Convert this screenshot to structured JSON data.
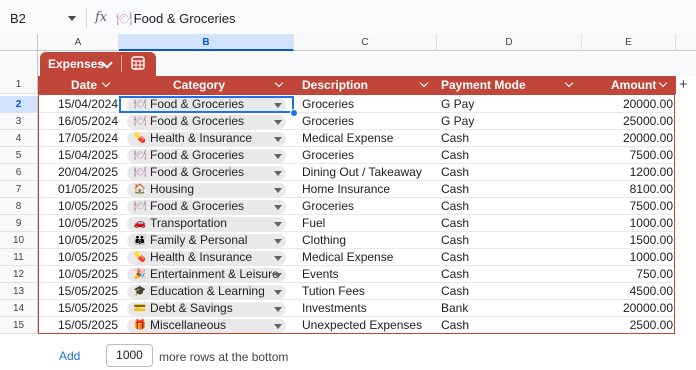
{
  "formula_bar": {
    "cell_ref": "B2",
    "fx": "fx",
    "content": "Food & Groceries",
    "content_icon": "🍽"
  },
  "columns": [
    "A",
    "B",
    "C",
    "D",
    "E"
  ],
  "row_numbers": [
    "1",
    "2",
    "3",
    "4",
    "5",
    "6",
    "7",
    "8",
    "9",
    "10",
    "11",
    "12",
    "13",
    "14",
    "15"
  ],
  "table": {
    "name": "Expenses",
    "accent_color": "#c0463a",
    "headers": {
      "date": "Date",
      "category": "Category",
      "description": "Description",
      "payment": "Payment Mode",
      "amount": "Amount"
    },
    "rows": [
      {
        "date": "15/04/2024",
        "category": "Food & Groceries",
        "icon": "🍽",
        "description": "Groceries",
        "payment": "G Pay",
        "amount": "20000.00"
      },
      {
        "date": "16/05/2024",
        "category": "Food & Groceries",
        "icon": "🍽",
        "description": "Groceries",
        "payment": "G Pay",
        "amount": "25000.00"
      },
      {
        "date": "17/05/2024",
        "category": "Health & Insurance",
        "icon": "💊",
        "description": "Medical Expense",
        "payment": "Cash",
        "amount": "20000.00"
      },
      {
        "date": "15/04/2025",
        "category": "Food & Groceries",
        "icon": "🍽",
        "description": "Groceries",
        "payment": "Cash",
        "amount": "7500.00"
      },
      {
        "date": "20/04/2025",
        "category": "Food & Groceries",
        "icon": "🍽",
        "description": "Dining Out / Takeaway",
        "payment": "Cash",
        "amount": "1200.00"
      },
      {
        "date": "01/05/2025",
        "category": "Housing",
        "icon": "🏠",
        "description": "Home Insurance",
        "payment": "Cash",
        "amount": "8100.00"
      },
      {
        "date": "10/05/2025",
        "category": "Food & Groceries",
        "icon": "🍽",
        "description": "Groceries",
        "payment": "Cash",
        "amount": "7500.00"
      },
      {
        "date": "10/05/2025",
        "category": "Transportation",
        "icon": "🚗",
        "description": "Fuel",
        "payment": "Cash",
        "amount": "1000.00"
      },
      {
        "date": "10/05/2025",
        "category": "Family & Personal",
        "icon": "👪",
        "description": "Clothing",
        "payment": "Cash",
        "amount": "1500.00"
      },
      {
        "date": "10/05/2025",
        "category": "Health & Insurance",
        "icon": "💊",
        "description": "Medical Expense",
        "payment": "Cash",
        "amount": "1000.00"
      },
      {
        "date": "10/05/2025",
        "category": "Entertainment & Leisure",
        "icon": "🎉",
        "description": "Events",
        "payment": "Cash",
        "amount": "750.00"
      },
      {
        "date": "15/05/2025",
        "category": "Education & Learning",
        "icon": "🎓",
        "description": "Tution Fees",
        "payment": "Cash",
        "amount": "4500.00"
      },
      {
        "date": "15/05/2025",
        "category": "Debt & Savings",
        "icon": "💳",
        "description": "Investments",
        "payment": "Bank",
        "amount": "20000.00"
      },
      {
        "date": "15/05/2025",
        "category": "Miscellaneous",
        "icon": "🎁",
        "description": "Unexpected Expenses",
        "payment": "Cash",
        "amount": "2500.00"
      }
    ]
  },
  "footer": {
    "add_label": "Add",
    "rows_value": "1000",
    "more_text": "more rows at the bottom"
  }
}
